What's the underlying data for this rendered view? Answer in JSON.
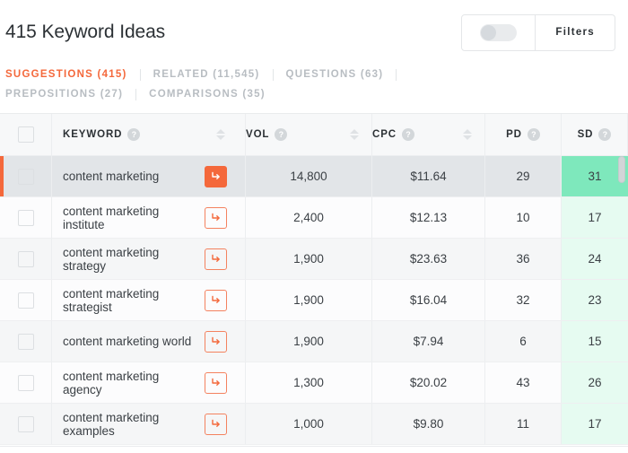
{
  "header": {
    "title": "415 Keyword Ideas",
    "toggle": {
      "name": "results-toggle",
      "state": "off"
    },
    "filters_label": "Filters"
  },
  "tabs": [
    {
      "label": "SUGGESTIONS (415)",
      "active": true,
      "key": "suggestions"
    },
    {
      "label": "RELATED (11,545)",
      "active": false,
      "key": "related"
    },
    {
      "label": "QUESTIONS (63)",
      "active": false,
      "key": "questions"
    },
    {
      "label": "PREPOSITIONS (27)",
      "active": false,
      "key": "prepositions"
    },
    {
      "label": "COMPARISONS (35)",
      "active": false,
      "key": "comparisons"
    }
  ],
  "table": {
    "columns": [
      {
        "label": "KEYWORD",
        "help": "?",
        "sortable": true
      },
      {
        "label": "VOL",
        "help": "?",
        "sortable": true
      },
      {
        "label": "CPC",
        "help": "?",
        "sortable": true
      },
      {
        "label": "PD",
        "help": "?",
        "sortable": false
      },
      {
        "label": "SD",
        "help": "?",
        "sortable": false
      }
    ],
    "rows": [
      {
        "keyword": "content marketing",
        "vol": "14,800",
        "cpc": "$11.64",
        "pd": "29",
        "sd": "31",
        "selected": true,
        "sd_hot": true
      },
      {
        "keyword": "content marketing institute",
        "vol": "2,400",
        "cpc": "$12.13",
        "pd": "10",
        "sd": "17",
        "selected": false,
        "sd_hot": false
      },
      {
        "keyword": "content marketing strategy",
        "vol": "1,900",
        "cpc": "$23.63",
        "pd": "36",
        "sd": "24",
        "selected": false,
        "sd_hot": false
      },
      {
        "keyword": "content marketing strategist",
        "vol": "1,900",
        "cpc": "$16.04",
        "pd": "32",
        "sd": "23",
        "selected": false,
        "sd_hot": false
      },
      {
        "keyword": "content marketing world",
        "vol": "1,900",
        "cpc": "$7.94",
        "pd": "6",
        "sd": "15",
        "selected": false,
        "sd_hot": false
      },
      {
        "keyword": "content marketing agency",
        "vol": "1,300",
        "cpc": "$20.02",
        "pd": "43",
        "sd": "26",
        "selected": false,
        "sd_hot": false
      },
      {
        "keyword": "content marketing examples",
        "vol": "1,000",
        "cpc": "$9.80",
        "pd": "11",
        "sd": "17",
        "selected": false,
        "sd_hot": false
      }
    ]
  },
  "colors": {
    "accent": "#f4683b",
    "tab_inactive": "#b8bdc2",
    "sd_hot": "#7ee8bc",
    "sd_pale": "#e6fbf1",
    "row_selected": "#e2e5e8"
  }
}
